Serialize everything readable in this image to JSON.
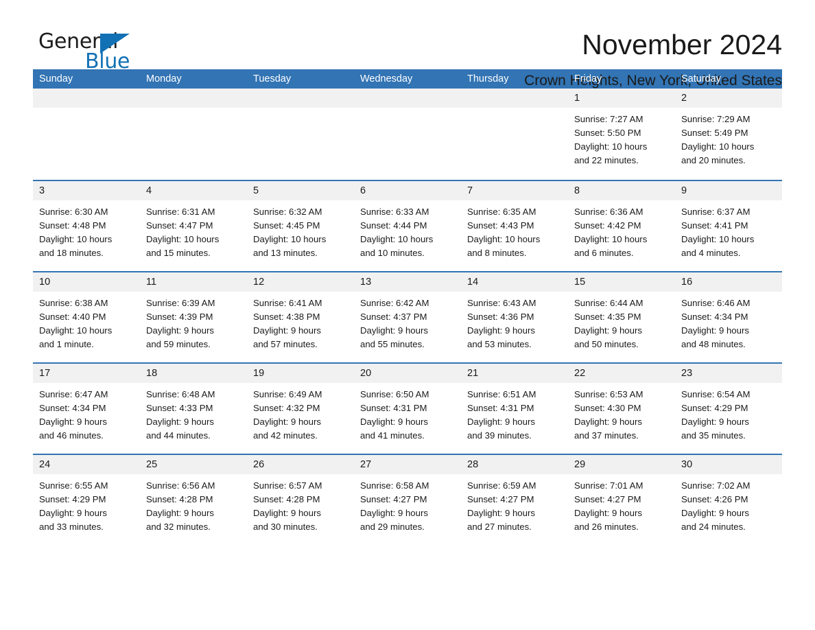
{
  "brand": {
    "name_part1": "General",
    "name_part2": "Blue",
    "triangle_icon": "triangle-icon",
    "accent_color": "#1271b5"
  },
  "header": {
    "title": "November 2024",
    "location": "Crown Heights, New York, United States"
  },
  "calendar": {
    "header_bg": "#3274b4",
    "day_band_bg": "#f1f1f1",
    "weekdays": [
      "Sunday",
      "Monday",
      "Tuesday",
      "Wednesday",
      "Thursday",
      "Friday",
      "Saturday"
    ],
    "weeks": [
      [
        {
          "day": "",
          "lines": []
        },
        {
          "day": "",
          "lines": []
        },
        {
          "day": "",
          "lines": []
        },
        {
          "day": "",
          "lines": []
        },
        {
          "day": "",
          "lines": []
        },
        {
          "day": "1",
          "lines": [
            "Sunrise: 7:27 AM",
            "Sunset: 5:50 PM",
            "Daylight: 10 hours",
            "and 22 minutes."
          ]
        },
        {
          "day": "2",
          "lines": [
            "Sunrise: 7:29 AM",
            "Sunset: 5:49 PM",
            "Daylight: 10 hours",
            "and 20 minutes."
          ]
        }
      ],
      [
        {
          "day": "3",
          "lines": [
            "Sunrise: 6:30 AM",
            "Sunset: 4:48 PM",
            "Daylight: 10 hours",
            "and 18 minutes."
          ]
        },
        {
          "day": "4",
          "lines": [
            "Sunrise: 6:31 AM",
            "Sunset: 4:47 PM",
            "Daylight: 10 hours",
            "and 15 minutes."
          ]
        },
        {
          "day": "5",
          "lines": [
            "Sunrise: 6:32 AM",
            "Sunset: 4:45 PM",
            "Daylight: 10 hours",
            "and 13 minutes."
          ]
        },
        {
          "day": "6",
          "lines": [
            "Sunrise: 6:33 AM",
            "Sunset: 4:44 PM",
            "Daylight: 10 hours",
            "and 10 minutes."
          ]
        },
        {
          "day": "7",
          "lines": [
            "Sunrise: 6:35 AM",
            "Sunset: 4:43 PM",
            "Daylight: 10 hours",
            "and 8 minutes."
          ]
        },
        {
          "day": "8",
          "lines": [
            "Sunrise: 6:36 AM",
            "Sunset: 4:42 PM",
            "Daylight: 10 hours",
            "and 6 minutes."
          ]
        },
        {
          "day": "9",
          "lines": [
            "Sunrise: 6:37 AM",
            "Sunset: 4:41 PM",
            "Daylight: 10 hours",
            "and 4 minutes."
          ]
        }
      ],
      [
        {
          "day": "10",
          "lines": [
            "Sunrise: 6:38 AM",
            "Sunset: 4:40 PM",
            "Daylight: 10 hours",
            "and 1 minute."
          ]
        },
        {
          "day": "11",
          "lines": [
            "Sunrise: 6:39 AM",
            "Sunset: 4:39 PM",
            "Daylight: 9 hours",
            "and 59 minutes."
          ]
        },
        {
          "day": "12",
          "lines": [
            "Sunrise: 6:41 AM",
            "Sunset: 4:38 PM",
            "Daylight: 9 hours",
            "and 57 minutes."
          ]
        },
        {
          "day": "13",
          "lines": [
            "Sunrise: 6:42 AM",
            "Sunset: 4:37 PM",
            "Daylight: 9 hours",
            "and 55 minutes."
          ]
        },
        {
          "day": "14",
          "lines": [
            "Sunrise: 6:43 AM",
            "Sunset: 4:36 PM",
            "Daylight: 9 hours",
            "and 53 minutes."
          ]
        },
        {
          "day": "15",
          "lines": [
            "Sunrise: 6:44 AM",
            "Sunset: 4:35 PM",
            "Daylight: 9 hours",
            "and 50 minutes."
          ]
        },
        {
          "day": "16",
          "lines": [
            "Sunrise: 6:46 AM",
            "Sunset: 4:34 PM",
            "Daylight: 9 hours",
            "and 48 minutes."
          ]
        }
      ],
      [
        {
          "day": "17",
          "lines": [
            "Sunrise: 6:47 AM",
            "Sunset: 4:34 PM",
            "Daylight: 9 hours",
            "and 46 minutes."
          ]
        },
        {
          "day": "18",
          "lines": [
            "Sunrise: 6:48 AM",
            "Sunset: 4:33 PM",
            "Daylight: 9 hours",
            "and 44 minutes."
          ]
        },
        {
          "day": "19",
          "lines": [
            "Sunrise: 6:49 AM",
            "Sunset: 4:32 PM",
            "Daylight: 9 hours",
            "and 42 minutes."
          ]
        },
        {
          "day": "20",
          "lines": [
            "Sunrise: 6:50 AM",
            "Sunset: 4:31 PM",
            "Daylight: 9 hours",
            "and 41 minutes."
          ]
        },
        {
          "day": "21",
          "lines": [
            "Sunrise: 6:51 AM",
            "Sunset: 4:31 PM",
            "Daylight: 9 hours",
            "and 39 minutes."
          ]
        },
        {
          "day": "22",
          "lines": [
            "Sunrise: 6:53 AM",
            "Sunset: 4:30 PM",
            "Daylight: 9 hours",
            "and 37 minutes."
          ]
        },
        {
          "day": "23",
          "lines": [
            "Sunrise: 6:54 AM",
            "Sunset: 4:29 PM",
            "Daylight: 9 hours",
            "and 35 minutes."
          ]
        }
      ],
      [
        {
          "day": "24",
          "lines": [
            "Sunrise: 6:55 AM",
            "Sunset: 4:29 PM",
            "Daylight: 9 hours",
            "and 33 minutes."
          ]
        },
        {
          "day": "25",
          "lines": [
            "Sunrise: 6:56 AM",
            "Sunset: 4:28 PM",
            "Daylight: 9 hours",
            "and 32 minutes."
          ]
        },
        {
          "day": "26",
          "lines": [
            "Sunrise: 6:57 AM",
            "Sunset: 4:28 PM",
            "Daylight: 9 hours",
            "and 30 minutes."
          ]
        },
        {
          "day": "27",
          "lines": [
            "Sunrise: 6:58 AM",
            "Sunset: 4:27 PM",
            "Daylight: 9 hours",
            "and 29 minutes."
          ]
        },
        {
          "day": "28",
          "lines": [
            "Sunrise: 6:59 AM",
            "Sunset: 4:27 PM",
            "Daylight: 9 hours",
            "and 27 minutes."
          ]
        },
        {
          "day": "29",
          "lines": [
            "Sunrise: 7:01 AM",
            "Sunset: 4:27 PM",
            "Daylight: 9 hours",
            "and 26 minutes."
          ]
        },
        {
          "day": "30",
          "lines": [
            "Sunrise: 7:02 AM",
            "Sunset: 4:26 PM",
            "Daylight: 9 hours",
            "and 24 minutes."
          ]
        }
      ]
    ]
  }
}
